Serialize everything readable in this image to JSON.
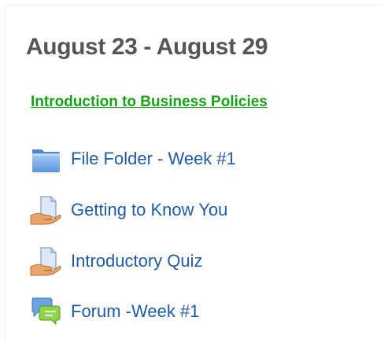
{
  "section": {
    "title": "August 23 - August 29",
    "summary_link": "Introduction to Business Policies"
  },
  "activities": [
    {
      "label": "File Folder - Week #1",
      "icon": "folder-icon"
    },
    {
      "label": "Getting to Know You",
      "icon": "document-hand-icon"
    },
    {
      "label": "Introductory Quiz",
      "icon": "document-hand-icon"
    },
    {
      "label": "Forum -Week #1",
      "icon": "forum-icon"
    }
  ],
  "colors": {
    "title": "#555555",
    "summary_link": "#15a315",
    "activity_link": "#1f5ba6"
  }
}
